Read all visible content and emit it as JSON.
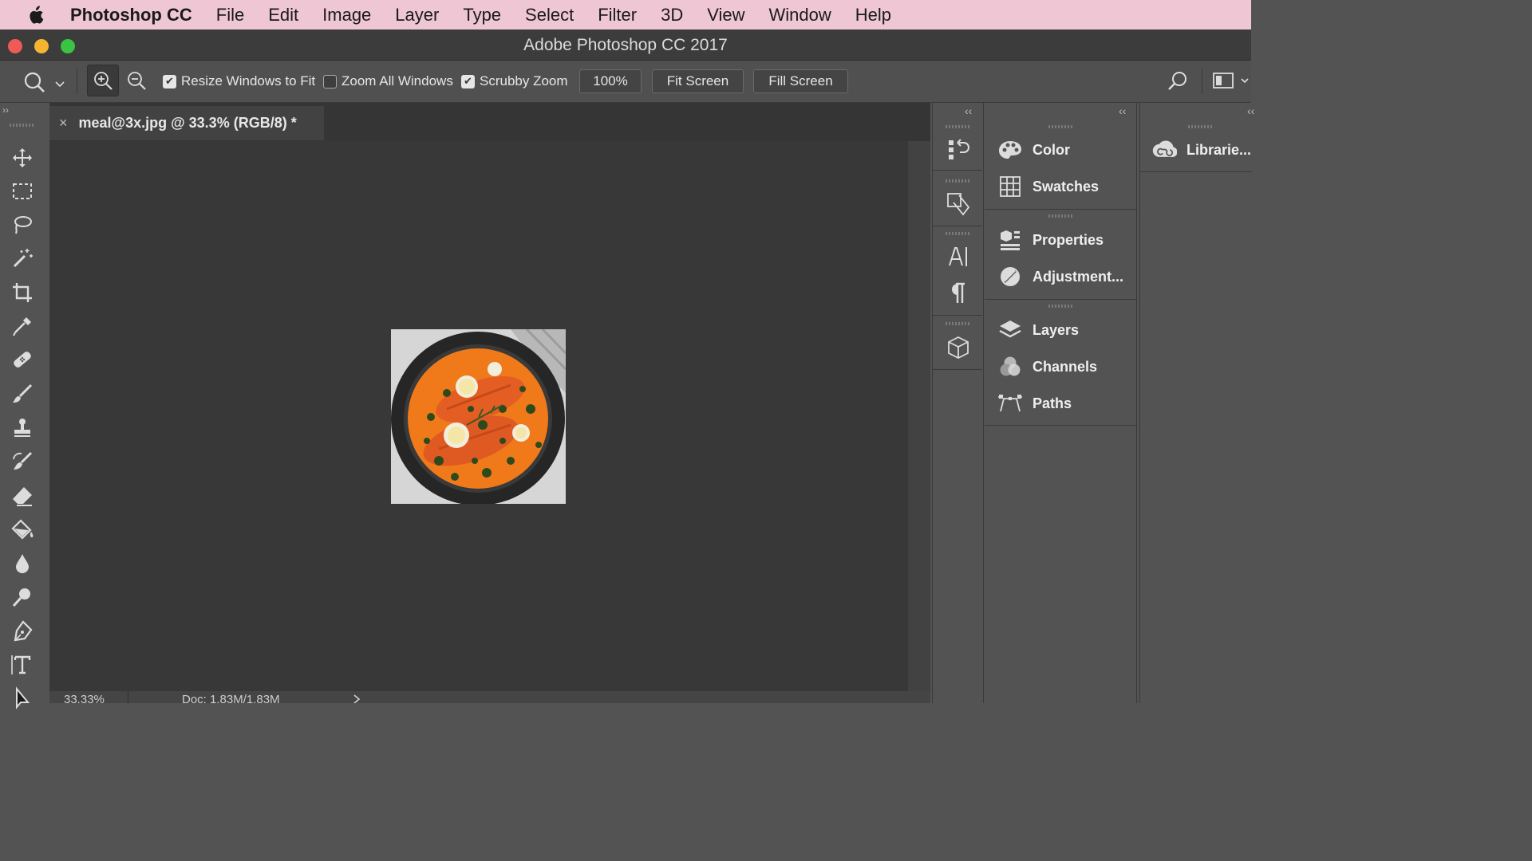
{
  "menubar": {
    "app_name": "Photoshop CC",
    "items": [
      "File",
      "Edit",
      "Image",
      "Layer",
      "Type",
      "Select",
      "Filter",
      "3D",
      "View",
      "Window",
      "Help"
    ]
  },
  "window": {
    "title": "Adobe Photoshop CC 2017"
  },
  "options": {
    "resize_windows": {
      "label": "Resize Windows to Fit",
      "checked": true
    },
    "zoom_all": {
      "label": "Zoom All Windows",
      "checked": false
    },
    "scrubby_zoom": {
      "label": "Scrubby Zoom",
      "checked": true
    },
    "zoom_value": "100%",
    "fit_screen": "Fit Screen",
    "fill_screen": "Fill Screen"
  },
  "document": {
    "tab_title": "meal@3x.jpg @ 33.3% (RGB/8) *",
    "close_glyph": "×",
    "status_zoom": "33.33%",
    "status_doc": "Doc: 1.83M/1.83M"
  },
  "panels": {
    "group1": [
      "Color",
      "Swatches"
    ],
    "group2": [
      "Properties",
      "Adjustment..."
    ],
    "group3": [
      "Layers",
      "Channels",
      "Paths"
    ],
    "libraries": "Librarie..."
  },
  "colors": {
    "menubar": "#efc6d4",
    "workspace": "#383838",
    "panel": "#535353",
    "food_sauce": "#f07a1a"
  }
}
